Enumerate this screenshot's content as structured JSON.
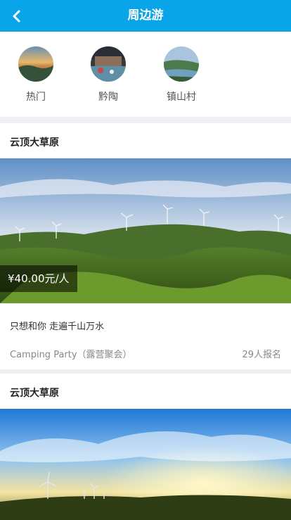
{
  "header": {
    "title": "周边游"
  },
  "categories": [
    {
      "label": "热门",
      "icon": "hot-thumbnail"
    },
    {
      "label": "黔陶",
      "icon": "qiantao-thumbnail"
    },
    {
      "label": "镇山村",
      "icon": "zhenshan-thumbnail"
    }
  ],
  "cards": [
    {
      "title": "云顶大草原",
      "price": "¥40.00元/人",
      "slogan": "只想和你 走遍千山万水",
      "activity": "Camping Party（露营聚会）",
      "signup": "29人报名"
    },
    {
      "title": "云顶大草原"
    }
  ],
  "colors": {
    "accent": "#0aa5e8"
  }
}
